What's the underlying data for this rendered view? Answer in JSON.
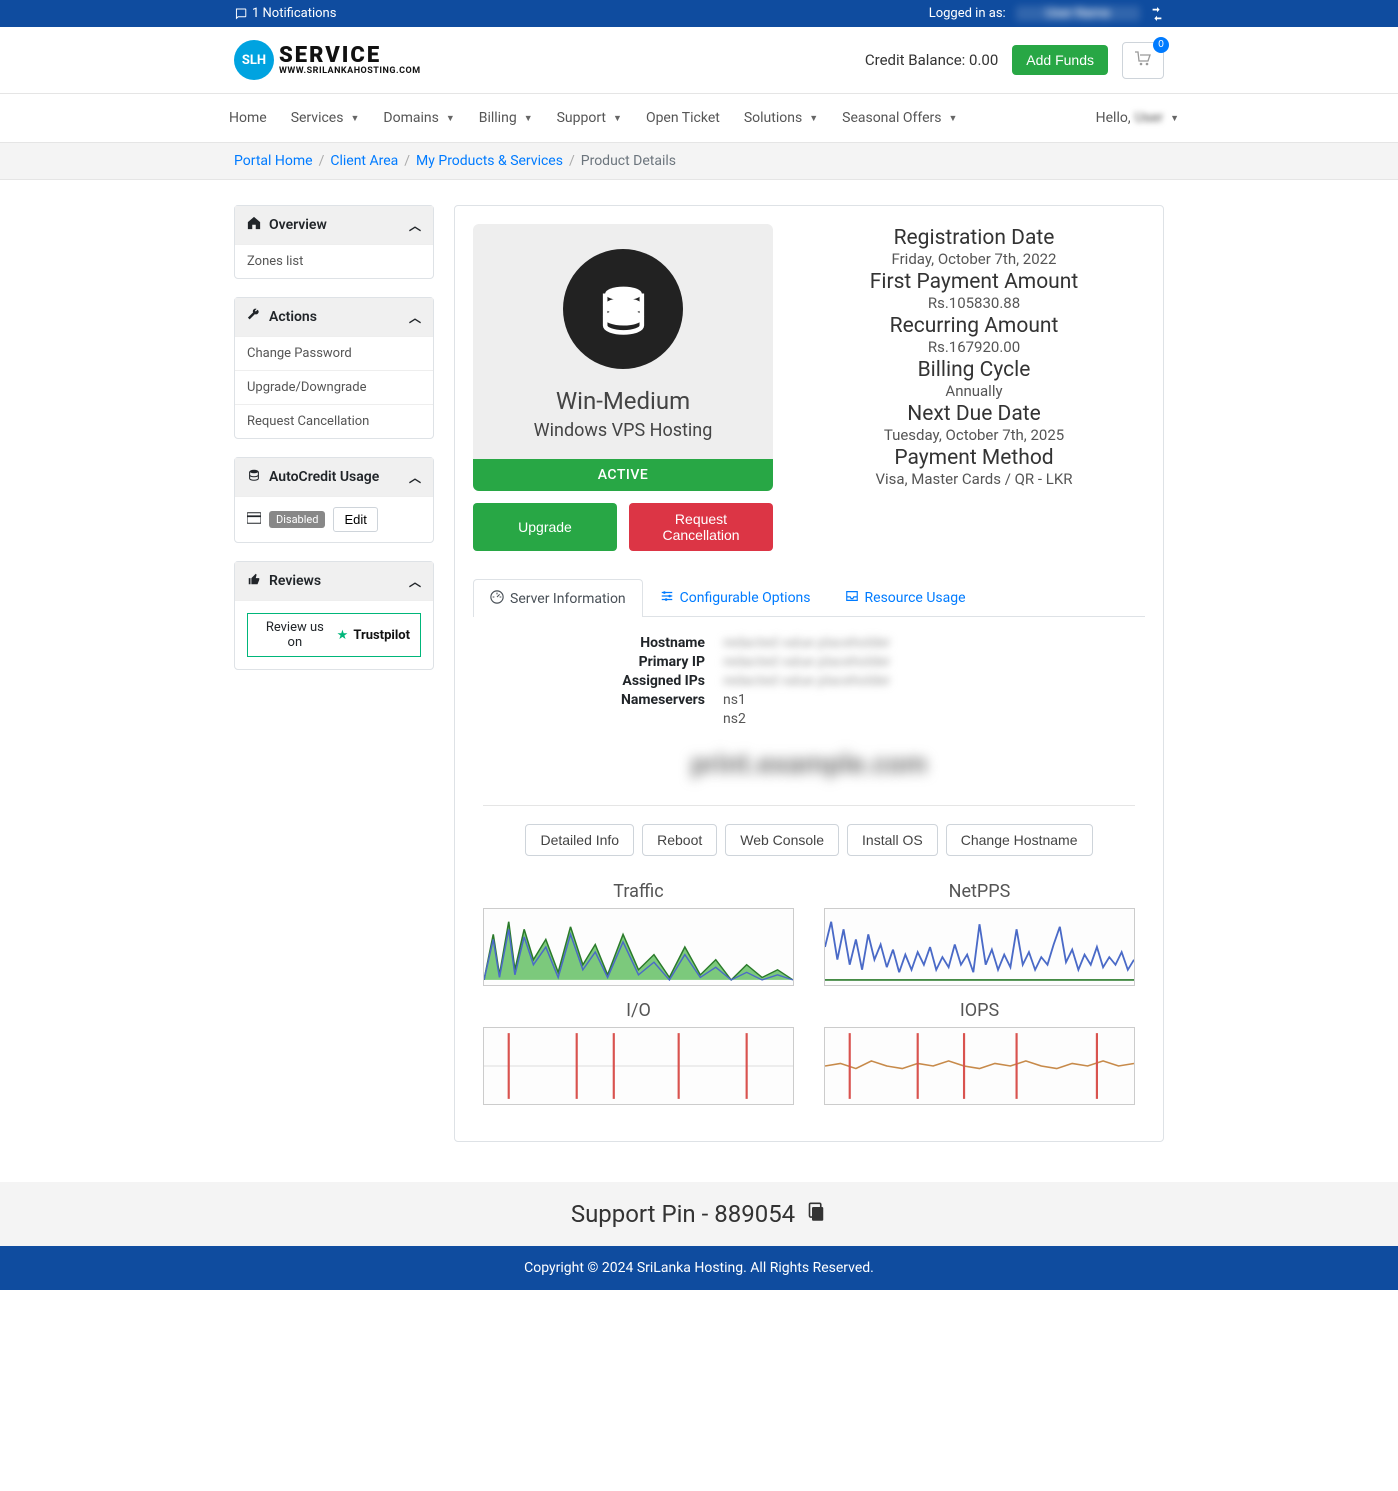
{
  "topbar": {
    "notifications": "1 Notifications",
    "logged_in_label": "Logged in as:",
    "logged_in_user": "User Name"
  },
  "header": {
    "logo_main": "SERVICE",
    "logo_sub": "WWW.SRILANKAHOSTING.COM",
    "logo_badge": "SLH",
    "credit_label": "Credit Balance: 0.00",
    "add_funds": "Add Funds",
    "cart_count": "0"
  },
  "nav": {
    "items": [
      "Home",
      "Services",
      "Domains",
      "Billing",
      "Support",
      "Open Ticket",
      "Solutions",
      "Seasonal Offers"
    ],
    "dropdown_flags": [
      false,
      true,
      true,
      true,
      true,
      false,
      true,
      true
    ],
    "hello": "Hello,",
    "hello_name": "User"
  },
  "breadcrumb": {
    "links": [
      "Portal Home",
      "Client Area",
      "My Products & Services"
    ],
    "current": "Product Details"
  },
  "sidebar": {
    "overview": {
      "title": "Overview",
      "items": [
        "Zones list"
      ]
    },
    "actions": {
      "title": "Actions",
      "items": [
        "Change Password",
        "Upgrade/Downgrade",
        "Request Cancellation"
      ]
    },
    "autocredit": {
      "title": "AutoCredit Usage",
      "status": "Disabled",
      "edit": "Edit"
    },
    "reviews": {
      "title": "Reviews",
      "review_us": "Review us on",
      "trustpilot": "Trustpilot"
    }
  },
  "product": {
    "name": "Win-Medium",
    "category": "Windows VPS Hosting",
    "status": "ACTIVE",
    "upgrade": "Upgrade",
    "cancel": "Request Cancellation",
    "info": [
      {
        "label": "Registration Date",
        "value": "Friday, October 7th, 2022"
      },
      {
        "label": "First Payment Amount",
        "value": "Rs.105830.88"
      },
      {
        "label": "Recurring Amount",
        "value": "Rs.167920.00"
      },
      {
        "label": "Billing Cycle",
        "value": "Annually"
      },
      {
        "label": "Next Due Date",
        "value": "Tuesday, October 7th, 2025"
      },
      {
        "label": "Payment Method",
        "value": "Visa, Master Cards / QR - LKR"
      }
    ]
  },
  "tabs": {
    "server_info": "Server Information",
    "config_options": "Configurable Options",
    "resource_usage": "Resource Usage"
  },
  "server": {
    "fields": [
      {
        "k": "Hostname",
        "v": "",
        "blur": true
      },
      {
        "k": "Primary IP",
        "v": "",
        "blur": true
      },
      {
        "k": "Assigned IPs",
        "v": "",
        "blur": true
      },
      {
        "k": "Nameservers",
        "v": "ns1",
        "blur": false
      },
      {
        "k": "",
        "v": "ns2",
        "blur": false
      }
    ],
    "domain_heading": "print.example.com",
    "actions": [
      "Detailed Info",
      "Reboot",
      "Web Console",
      "Install OS",
      "Change Hostname"
    ],
    "charts": [
      "Traffic",
      "NetPPS",
      "I/O",
      "IOPS"
    ]
  },
  "support_pin": {
    "label": "Support Pin - ",
    "value": "889054"
  },
  "footer": "Copyright © 2024 SriLanka Hosting. All Rights Reserved."
}
